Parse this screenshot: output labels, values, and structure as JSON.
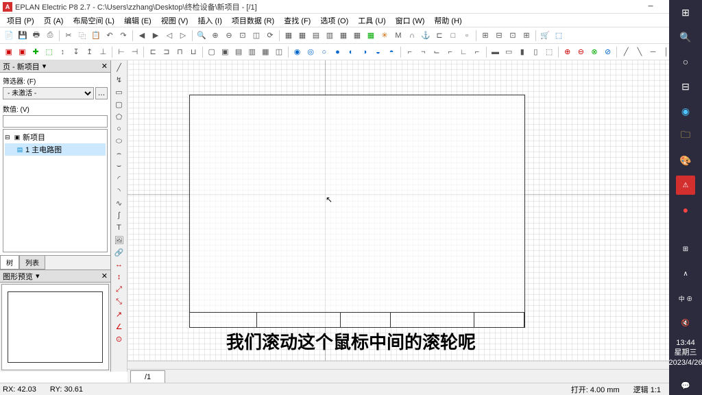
{
  "title": "EPLAN Electric P8 2.7 - C:\\Users\\zzhang\\Desktop\\终检设备\\新项目 - [/1]",
  "menu": [
    "项目 (P)",
    "页 (A)",
    "布局空间 (L)",
    "编辑 (E)",
    "视图 (V)",
    "插入 (I)",
    "项目数据 (R)",
    "查找 (F)",
    "选项 (O)",
    "工具 (U)",
    "窗口 (W)",
    "帮助 (H)"
  ],
  "left_panel": {
    "title": "页 - 新项目",
    "filter_label": "筛选器: (F)",
    "filter_value": "- 未激活 -",
    "value_label": "数值: (V)",
    "tree_root": "新项目",
    "tree_child": "1 主电路图",
    "tabs": [
      "树",
      "列表"
    ],
    "preview_title": "图形预览"
  },
  "sheet_tab": "/1",
  "subtitle": "我们滚动这个鼠标中间的滚轮呢",
  "status": {
    "rx": "RX: 42.03",
    "ry": "RY: 30.61",
    "grid": "打开: 4.00 mm",
    "zoom": "逻辑 1:1"
  },
  "clock": {
    "time": "13:44",
    "day": "星期三",
    "date": "2023/4/26"
  }
}
